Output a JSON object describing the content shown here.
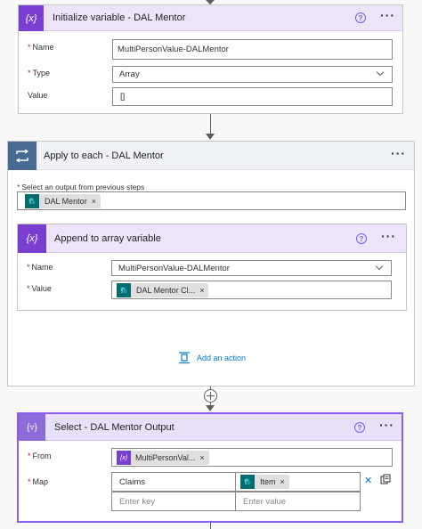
{
  "init_card": {
    "title": "Initialize variable - DAL Mentor",
    "name_label": "Name",
    "name_value": "MultiPersonValue-DALMentor",
    "type_label": "Type",
    "type_value": "Array",
    "value_label": "Value",
    "value_value": "[]"
  },
  "apply_card": {
    "title": "Apply to each - DAL Mentor",
    "select_output_label": "Select an output from previous steps",
    "token_label": "DAL Mentor",
    "add_action_label": "Add an action"
  },
  "append_card": {
    "title": "Append to array variable",
    "name_label": "Name",
    "name_value": "MultiPersonValue-DALMentor",
    "value_label": "Value",
    "value_token": "DAL Mentor Cl..."
  },
  "select_card": {
    "title": "Select - DAL Mentor Output",
    "from_label": "From",
    "from_token": "MultiPersonVal...",
    "map_label": "Map",
    "map_key": "Claims",
    "map_value_token": "Item",
    "key_placeholder": "Enter key",
    "value_placeholder": "Enter value"
  },
  "icons": {
    "variable_icon_glyph": "{x}",
    "help_glyph": "?",
    "more_glyph": "···",
    "token_close_glyph": "×",
    "delete_glyph": "✕"
  },
  "colors": {
    "variable_purple": "#7a3fd1",
    "variable_header_bg": "#ede4fa",
    "loop_blue": "#486991",
    "loop_header_bg": "#eef1f5",
    "sharepoint_teal": "#036c70",
    "select_header_bg": "#e8e0f8",
    "selected_border": "#8a5cf5",
    "link_blue": "#0078d4"
  }
}
